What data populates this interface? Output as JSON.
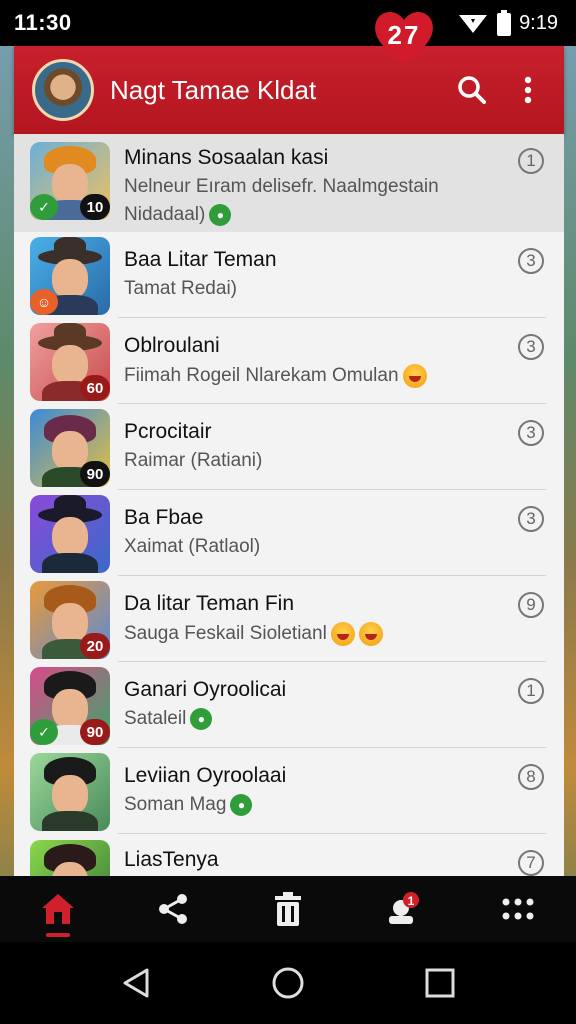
{
  "status_bar": {
    "time": "11:30",
    "right_time": "9:19",
    "notification_count": "27"
  },
  "app_bar": {
    "title": "Nagt Tamae Kldat",
    "search_icon": "search-icon",
    "menu_icon": "more-vert-icon"
  },
  "colors": {
    "accent": "#c8202c",
    "list_bg": "#f3f3f3",
    "highlight_row": "#e2e2e2"
  },
  "contacts": [
    {
      "name": "Minans Sosaalan kasi",
      "line1": "Nelneur Eıram delisefr. Naalmgestain",
      "line2": "Nidadaal)",
      "count": "1",
      "badge": "10",
      "badge_style": "dark",
      "icon": "chat-green"
    },
    {
      "name": "Baa Litar Teman",
      "line1": "Tamat Redai)",
      "count": "3",
      "badge": "",
      "icon": "orange-emoji"
    },
    {
      "name": "Oblroulani",
      "line1": "Fiimah Rogeil Nlarekam Omulan",
      "count": "3",
      "badge": "60",
      "badge_style": "red",
      "icon": "smile-emoji"
    },
    {
      "name": "Pcrocitair",
      "line1": "Raimar (Ratiani)",
      "count": "3",
      "badge": "90",
      "badge_style": "dark",
      "icon": ""
    },
    {
      "name": "Ba Fbae",
      "line1": "Xaimat (Ratlaol)",
      "count": "3",
      "badge": "",
      "icon": ""
    },
    {
      "name": "Da litar Teman Fin",
      "line1": "Sauga Feskail Sioletianl",
      "count": "9",
      "badge": "20",
      "badge_style": "red",
      "icon": "smile-emoji"
    },
    {
      "name": "Ganari Oyroolicai",
      "line1": "Sataleil",
      "count": "1",
      "badge": "90",
      "badge_style": "red",
      "icon": "chat-green"
    },
    {
      "name": "Leviian Oyroolaai",
      "line1": "Soman Mag",
      "count": "8",
      "badge": "",
      "icon": "chat-green"
    },
    {
      "name": "LiasTenya",
      "line1": "",
      "count": "7",
      "badge": "",
      "icon": ""
    }
  ],
  "bottom_nav": [
    {
      "name": "home-icon",
      "active": true
    },
    {
      "name": "share-icon",
      "active": false
    },
    {
      "name": "trash-icon",
      "active": false
    },
    {
      "name": "alerts-icon",
      "active": false,
      "badge": "1"
    },
    {
      "name": "apps-grid-icon",
      "active": false
    }
  ],
  "system_nav": [
    "back-icon",
    "home-circle-icon",
    "recents-icon"
  ]
}
